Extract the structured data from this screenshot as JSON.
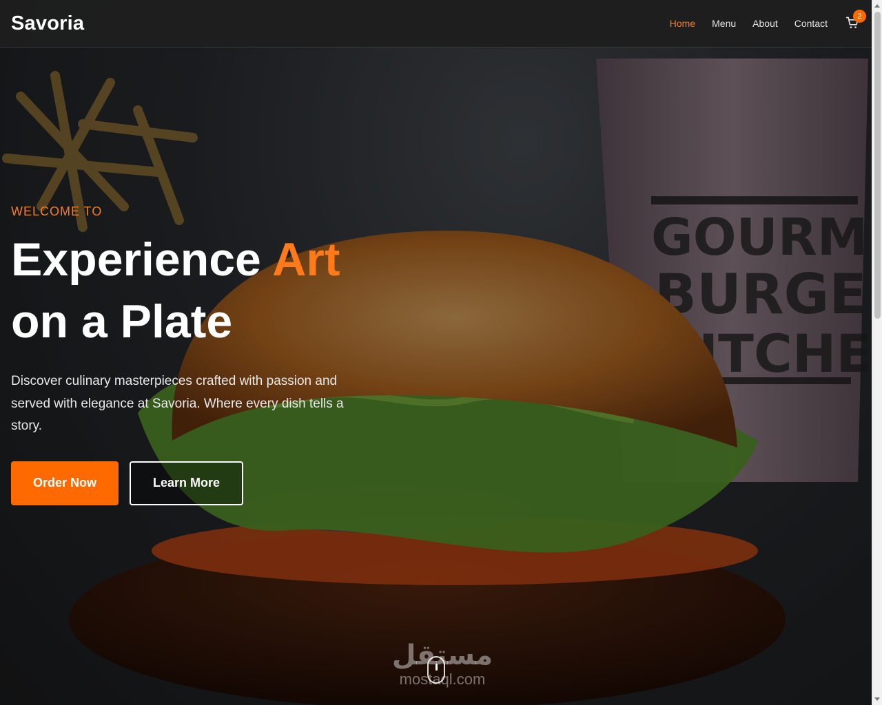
{
  "brand": {
    "name": "Savoria"
  },
  "nav": {
    "items": [
      {
        "label": "Home",
        "active": true
      },
      {
        "label": "Menu",
        "active": false
      },
      {
        "label": "About",
        "active": false
      },
      {
        "label": "Contact",
        "active": false
      }
    ],
    "cart_count": "2"
  },
  "hero": {
    "eyebrow": "WELCOME TO",
    "headline_part1": "Experience ",
    "headline_accent": "Art",
    "headline_part2": "on a Plate",
    "lead": "Discover culinary masterpieces crafted with passion and served with elegance at Savoria. Where every dish tells a story.",
    "primary_button": "Order Now",
    "secondary_button": "Learn More",
    "background_image": "burger-photo",
    "cup_lines": [
      "GOURMET",
      "BURGER",
      "KITCHEN"
    ]
  },
  "watermark": {
    "arabic": "مستقل",
    "latin": "mostaql.com"
  },
  "icons": {
    "cart": "cart-icon",
    "scroll": "mouse-scroll-icon"
  },
  "colors": {
    "accent": "#ff7a1a",
    "button": "#ff6a00",
    "navbar": "#1e1e1e",
    "text": "#ffffff"
  }
}
